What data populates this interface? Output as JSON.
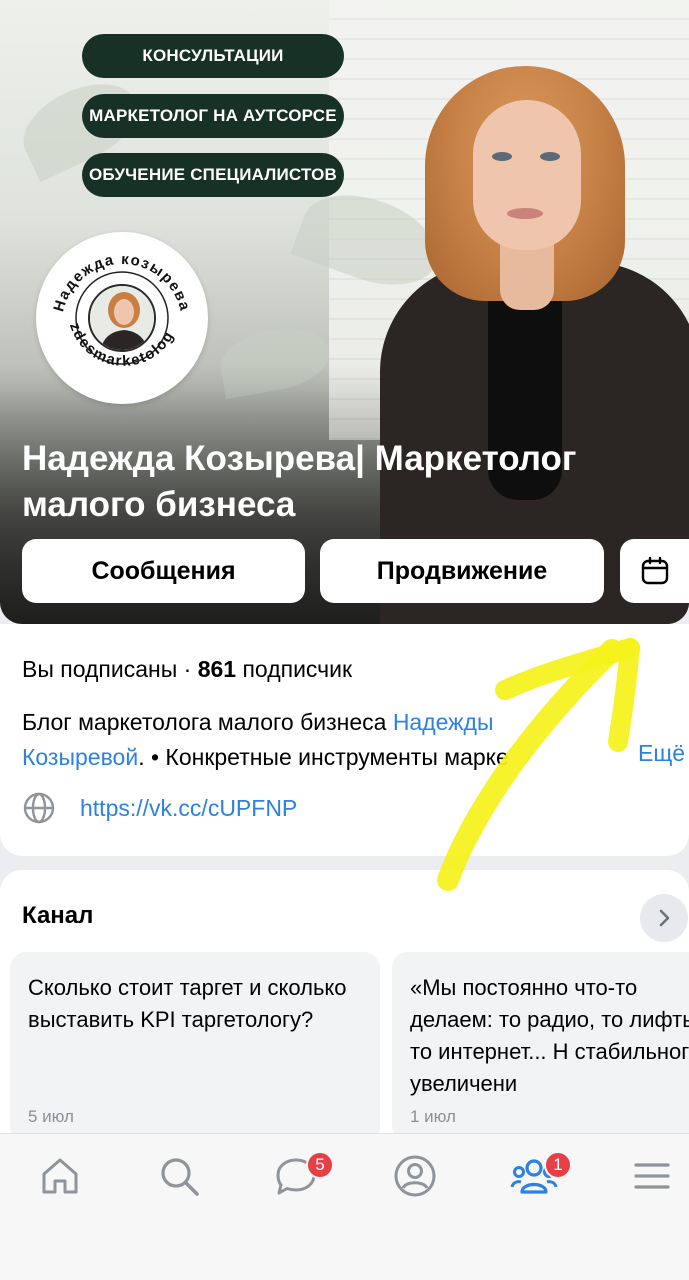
{
  "cover": {
    "services": [
      "КОНСУЛЬТАЦИИ",
      "МАРКЕТОЛОГ НА АУТСОРСЕ",
      "ОБУЧЕНИЕ СПЕЦИАЛИСТОВ"
    ],
    "avatar_ring_top": "Надежда козырева",
    "avatar_ring_bottom": "zdesmarketolog",
    "title": "Надежда Козырева| Маркетолог малого бизнеса"
  },
  "actions": {
    "messages_label": "Сообщения",
    "promote_label": "Продвижение",
    "calendar_icon": "calendar-icon"
  },
  "info": {
    "subscribed": "Вы подписаны · ",
    "subscriber_count": "861",
    "subscriber_word": " подписчик",
    "desc_prefix": "Блог маркетолога малого бизнеса ",
    "desc_link": "Надежды Козыревой",
    "desc_dot": ".",
    "desc_rest": " • Конкретные инструменты марке",
    "more_label": "Ещё",
    "url": "https://vk.cc/cUPFNP",
    "globe_icon": "globe-icon"
  },
  "channel": {
    "title": "Канал",
    "posts": [
      {
        "text": "Сколько стоит таргет и сколько выставить KPI таргетологу?",
        "date": "5 июл"
      },
      {
        "text": "«Мы постоянно что-то делаем: то радио, то лифты, то интернет... Н стабильного увеличени",
        "date": "1 июл"
      }
    ]
  },
  "tabbar": {
    "home": "home-icon",
    "search": "search-icon",
    "messages": "chat-icon",
    "messages_badge": "5",
    "profile": "profile-icon",
    "communities": "communities-icon",
    "communities_badge": "1",
    "menu": "menu-icon"
  },
  "colors": {
    "accent": "#2d81e0",
    "pill_bg": "#173127",
    "badge": "#e63f45",
    "annotation": "#f5f21a"
  }
}
